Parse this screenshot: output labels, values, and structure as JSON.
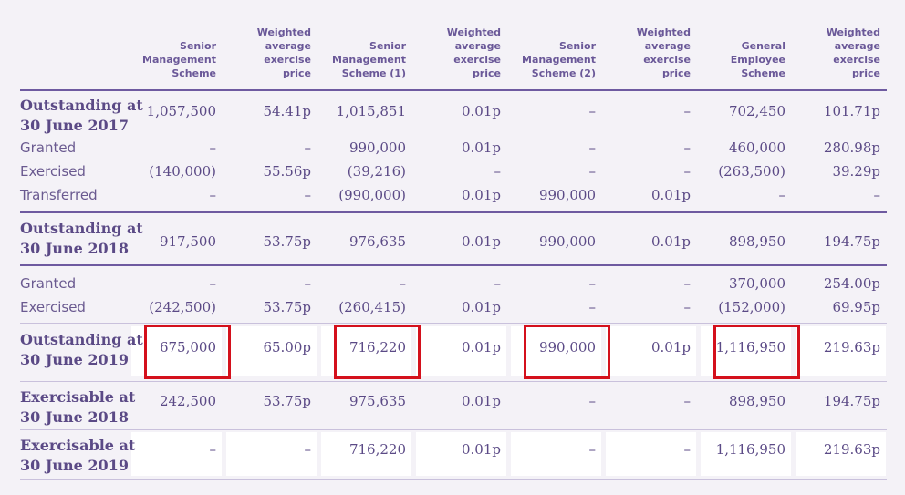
{
  "headers": [
    "Senior Management Scheme",
    "Weighted average exercise price",
    "Senior Management Scheme (1)",
    "Weighted average exercise price",
    "Senior Management Scheme (2)",
    "Weighted average exercise price",
    "General Employee Scheme",
    "Weighted average exercise price"
  ],
  "header_lines": [
    [
      "Senior",
      "Management",
      "Scheme"
    ],
    [
      "Weighted",
      "average",
      "exercise",
      "price"
    ],
    [
      "Senior",
      "Management",
      "Scheme (1)"
    ],
    [
      "Weighted",
      "average",
      "exercise",
      "price"
    ],
    [
      "Senior",
      "Management",
      "Scheme (2)"
    ],
    [
      "Weighted",
      "average",
      "exercise",
      "price"
    ],
    [
      "General",
      "Employee",
      "Scheme"
    ],
    [
      "Weighted",
      "average",
      "exercise",
      "price"
    ]
  ],
  "rows": [
    {
      "label": [
        "Outstanding at",
        "30 June 2017"
      ],
      "bold": true,
      "cells": [
        "1,057,500",
        "54.41p",
        "1,015,851",
        "0.01p",
        "–",
        "–",
        "702,450",
        "101.71p"
      ]
    },
    {
      "label": [
        "Granted"
      ],
      "bold": false,
      "cells": [
        "–",
        "–",
        "990,000",
        "0.01p",
        "–",
        "–",
        "460,000",
        "280.98p"
      ]
    },
    {
      "label": [
        "Exercised"
      ],
      "bold": false,
      "cells": [
        "(140,000)",
        "55.56p",
        "(39,216)",
        "–",
        "–",
        "–",
        "(263,500)",
        "39.29p"
      ]
    },
    {
      "label": [
        "Transferred"
      ],
      "bold": false,
      "cells": [
        "–",
        "–",
        "(990,000)",
        "0.01p",
        "990,000",
        "0.01p",
        "–",
        "–"
      ]
    },
    {
      "label": [
        "Outstanding at",
        "30 June 2018"
      ],
      "bold": true,
      "cells": [
        "917,500",
        "53.75p",
        "976,635",
        "0.01p",
        "990,000",
        "0.01p",
        "898,950",
        "194.75p"
      ]
    },
    {
      "label": [
        "Granted"
      ],
      "bold": false,
      "cells": [
        "–",
        "–",
        "–",
        "–",
        "–",
        "–",
        "370,000",
        "254.00p"
      ]
    },
    {
      "label": [
        "Exercised"
      ],
      "bold": false,
      "cells": [
        "(242,500)",
        "53.75p",
        "(260,415)",
        "0.01p",
        "–",
        "–",
        "(152,000)",
        "69.95p"
      ]
    },
    {
      "label": [
        "Outstanding at",
        "30 June 2019"
      ],
      "bold": true,
      "cells": [
        "675,000",
        "65.00p",
        "716,220",
        "0.01p",
        "990,000",
        "0.01p",
        "1,116,950",
        "219.63p"
      ]
    },
    {
      "label": [
        "Exercisable at",
        "30 June 2018"
      ],
      "bold": true,
      "cells": [
        "242,500",
        "53.75p",
        "975,635",
        "0.01p",
        "–",
        "–",
        "898,950",
        "194.75p"
      ]
    },
    {
      "label": [
        "Exercisable at",
        "30 June 2019"
      ],
      "bold": true,
      "cells": [
        "–",
        "–",
        "716,220",
        "0.01p",
        "–",
        "–",
        "1,116,950",
        "219.63p"
      ]
    }
  ],
  "highlighted": [
    "675,000",
    "716,220",
    "990,000",
    "1,116,950"
  ],
  "colors": {
    "text": "#5b4a86",
    "rule": "#6e5aa0",
    "highlight": "#d4101c",
    "background": "#f4f2f7"
  }
}
